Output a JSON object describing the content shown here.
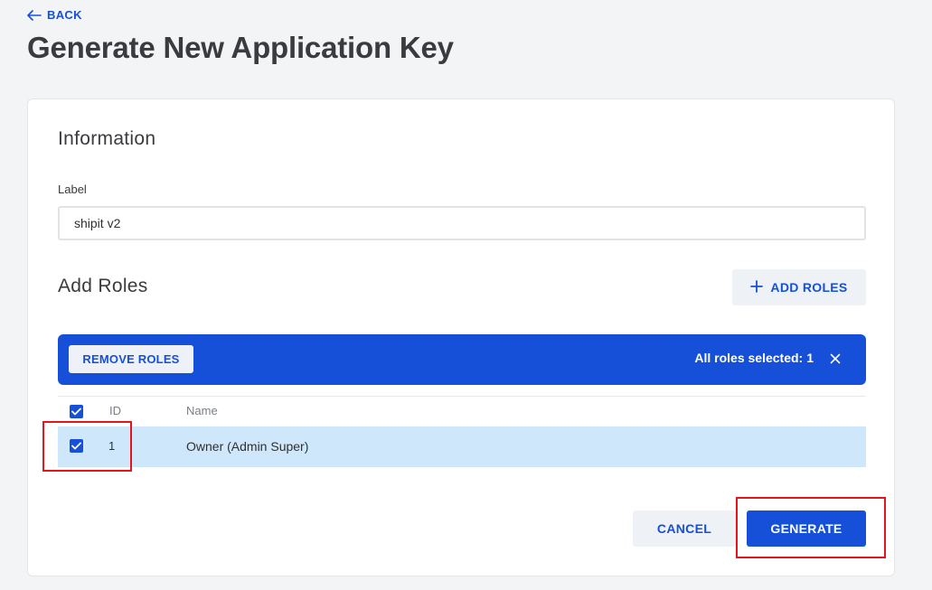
{
  "nav": {
    "back_label": "BACK"
  },
  "page": {
    "title": "Generate New Application Key"
  },
  "information": {
    "title": "Information",
    "label_field": {
      "label": "Label",
      "value": "shipit v2",
      "placeholder": ""
    }
  },
  "roles": {
    "title": "Add Roles",
    "add_button_label": "ADD ROLES",
    "selection_bar": {
      "remove_button_label": "REMOVE ROLES",
      "selected_text": "All roles selected:",
      "selected_count": "1"
    },
    "table": {
      "columns": [
        "ID",
        "Name"
      ],
      "rows": [
        {
          "id": "1",
          "name": "Owner (Admin Super)",
          "checked": true
        }
      ]
    }
  },
  "actions": {
    "cancel_label": "CANCEL",
    "generate_label": "GENERATE"
  },
  "colors": {
    "accent": "#1650d8",
    "selected_row": "#cfe7fb",
    "highlight": "#e8141c",
    "background": "#f3f4f6"
  },
  "icons": {
    "back": "arrow-left-icon",
    "add": "plus-icon",
    "close": "close-icon",
    "checkbox": "checkmark-icon"
  }
}
